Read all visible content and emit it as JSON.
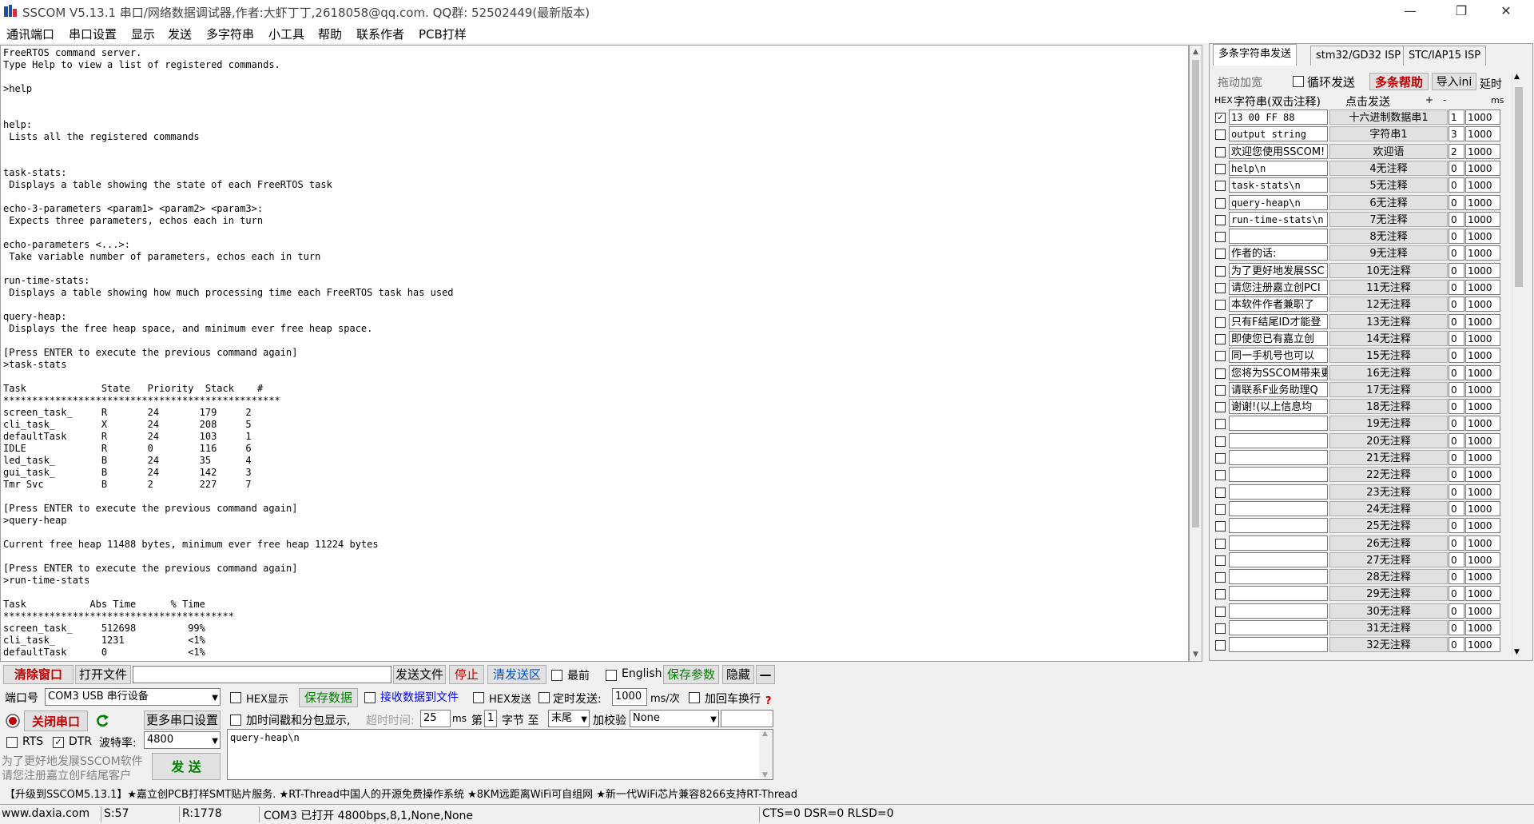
{
  "window": {
    "title": "SSCOM V5.13.1 串口/网络数据调试器,作者:大虾丁丁,2618058@qq.com. QQ群: 52502449(最新版本)",
    "minimize": "—",
    "maximize": "❐",
    "close": "✕"
  },
  "menu": [
    "通讯端口",
    "串口设置",
    "显示",
    "发送",
    "多字符串",
    "小工具",
    "帮助",
    "联系作者",
    "PCB打样"
  ],
  "console": {
    "text": "FreeRTOS command server.\nType Help to view a list of registered commands.\n\n>help\n\n\nhelp:\n Lists all the registered commands\n\n\ntask-stats:\n Displays a table showing the state of each FreeRTOS task\n\necho-3-parameters <param1> <param2> <param3>:\n Expects three parameters, echos each in turn\n\necho-parameters <...>:\n Take variable number of parameters, echos each in turn\n\nrun-time-stats:\n Displays a table showing how much processing time each FreeRTOS task has used\n\nquery-heap:\n Displays the free heap space, and minimum ever free heap space.\n\n[Press ENTER to execute the previous command again]\n>task-stats\n\nTask             State   Priority  Stack    #\n************************************************\nscreen_task_     R       24       179     2\ncli_task_        X       24       208     5\ndefaultTask      R       24       103     1\nIDLE             R       0        116     6\nled_task_        B       24       35      4\ngui_task_        B       24       142     3\nTmr Svc          B       2        227     7\n\n[Press ENTER to execute the previous command again]\n>query-heap\n\nCurrent free heap 11488 bytes, minimum ever free heap 11224 bytes\n\n[Press ENTER to execute the previous command again]\n>run-time-stats\n\nTask           Abs Time      % Time\n****************************************\nscreen_task_     512698         99%\ncli_task_        1231           <1%\ndefaultTask      0              <1%"
  },
  "right_panel": {
    "tabs": [
      "多条字符串发送",
      "stm32/GD32 ISP",
      "STC/IAP15 ISP"
    ],
    "drag_width": "拖动加宽",
    "loop_send": "循环发送",
    "multi_help": "多条帮助",
    "import_ini": "导入ini",
    "delay_label": "延时",
    "col_hex": "HEX",
    "col_string": "字符串(双击注释)",
    "col_click_send": "点击发送",
    "col_plus": "+",
    "col_minus": "-",
    "col_ms": "ms",
    "rows": [
      {
        "checked": true,
        "str": "13 00 FF 88",
        "btn": "十六进制数据串1",
        "ord": "1",
        "delay": "1000"
      },
      {
        "checked": false,
        "str": "output string",
        "btn": "字符串1",
        "ord": "3",
        "delay": "1000"
      },
      {
        "checked": false,
        "str": "欢迎您使用SSCOM!",
        "btn": "欢迎语",
        "ord": "2",
        "delay": "1000"
      },
      {
        "checked": false,
        "str": "help\\n",
        "btn": "4无注释",
        "ord": "0",
        "delay": "1000"
      },
      {
        "checked": false,
        "str": "task-stats\\n",
        "btn": "5无注释",
        "ord": "0",
        "delay": "1000"
      },
      {
        "checked": false,
        "str": "query-heap\\n",
        "btn": "6无注释",
        "ord": "0",
        "delay": "1000"
      },
      {
        "checked": false,
        "str": "run-time-stats\\n",
        "btn": "7无注释",
        "ord": "0",
        "delay": "1000"
      },
      {
        "checked": false,
        "str": "",
        "btn": "8无注释",
        "ord": "0",
        "delay": "1000"
      },
      {
        "checked": false,
        "str": "作者的话:",
        "btn": "9无注释",
        "ord": "0",
        "delay": "1000"
      },
      {
        "checked": false,
        "str": "为了更好地发展SSC",
        "btn": "10无注释",
        "ord": "0",
        "delay": "1000"
      },
      {
        "checked": false,
        "str": "请您注册嘉立创PCI",
        "btn": "11无注释",
        "ord": "0",
        "delay": "1000"
      },
      {
        "checked": false,
        "str": "本软件作者兼职了",
        "btn": "12无注释",
        "ord": "0",
        "delay": "1000"
      },
      {
        "checked": false,
        "str": "只有F结尾ID才能登",
        "btn": "13无注释",
        "ord": "0",
        "delay": "1000"
      },
      {
        "checked": false,
        "str": "即使您已有嘉立创",
        "btn": "14无注释",
        "ord": "0",
        "delay": "1000"
      },
      {
        "checked": false,
        "str": "同一手机号也可以",
        "btn": "15无注释",
        "ord": "0",
        "delay": "1000"
      },
      {
        "checked": false,
        "str": "您将为SSCOM带来更",
        "btn": "16无注释",
        "ord": "0",
        "delay": "1000"
      },
      {
        "checked": false,
        "str": "请联系F业务助理Q",
        "btn": "17无注释",
        "ord": "0",
        "delay": "1000"
      },
      {
        "checked": false,
        "str": "谢谢!(以上信息均",
        "btn": "18无注释",
        "ord": "0",
        "delay": "1000"
      },
      {
        "checked": false,
        "str": "",
        "btn": "19无注释",
        "ord": "0",
        "delay": "1000"
      },
      {
        "checked": false,
        "str": "",
        "btn": "20无注释",
        "ord": "0",
        "delay": "1000"
      },
      {
        "checked": false,
        "str": "",
        "btn": "21无注释",
        "ord": "0",
        "delay": "1000"
      },
      {
        "checked": false,
        "str": "",
        "btn": "22无注释",
        "ord": "0",
        "delay": "1000"
      },
      {
        "checked": false,
        "str": "",
        "btn": "23无注释",
        "ord": "0",
        "delay": "1000"
      },
      {
        "checked": false,
        "str": "",
        "btn": "24无注释",
        "ord": "0",
        "delay": "1000"
      },
      {
        "checked": false,
        "str": "",
        "btn": "25无注释",
        "ord": "0",
        "delay": "1000"
      },
      {
        "checked": false,
        "str": "",
        "btn": "26无注释",
        "ord": "0",
        "delay": "1000"
      },
      {
        "checked": false,
        "str": "",
        "btn": "27无注释",
        "ord": "0",
        "delay": "1000"
      },
      {
        "checked": false,
        "str": "",
        "btn": "28无注释",
        "ord": "0",
        "delay": "1000"
      },
      {
        "checked": false,
        "str": "",
        "btn": "29无注释",
        "ord": "0",
        "delay": "1000"
      },
      {
        "checked": false,
        "str": "",
        "btn": "30无注释",
        "ord": "0",
        "delay": "1000"
      },
      {
        "checked": false,
        "str": "",
        "btn": "31无注释",
        "ord": "0",
        "delay": "1000"
      },
      {
        "checked": false,
        "str": "",
        "btn": "32无注释",
        "ord": "0",
        "delay": "1000"
      }
    ]
  },
  "toolbar": {
    "clear_window": "清除窗口",
    "open_file": "打开文件",
    "file_path": "",
    "send_file": "发送文件",
    "stop": "停止",
    "clear_send": "清发送区",
    "topmost": "最前",
    "english": "English",
    "save_params": "保存参数",
    "hide": "隐藏",
    "collapse": "—"
  },
  "port": {
    "port_label": "端口号",
    "port_value": "COM3 USB 串行设备",
    "hex_display": "HEX显示",
    "save_data": "保存数据",
    "recv_to_file": "接收数据到文件",
    "hex_send": "HEX发送",
    "timed_send": "定时发送:",
    "interval": "1000",
    "interval_unit": "ms/次",
    "add_crlf": "加回车换行",
    "help_mark": "?",
    "close_port": "关闭串口",
    "more_settings": "更多串口设置",
    "timestamp": "加时间戳和分包显示,",
    "timeout_label": "超时时间:",
    "timeout_value": "25",
    "timeout_unit": "ms",
    "nth_label": "第",
    "nth_value": "1",
    "byte_label": "字节 至",
    "to_value": "末尾",
    "checksum_label": "加校验",
    "checksum_value": "None",
    "rts": "RTS",
    "dtr": "DTR",
    "baud_label": "波特率:",
    "baud_value": "4800",
    "send_text": "query-heap\\n",
    "ad_line1": "为了更好地发展SSCOM软件",
    "ad_line2": "请您注册嘉立创F结尾客户",
    "send_btn": "发 送"
  },
  "ticker": "【升级到SSCOM5.13.1】★嘉立创PCB打样SMT贴片服务. ★RT-Thread中国人的开源免费操作系统 ★8KM远距离WiFi可自组网 ★新一代WiFi芯片兼容8266支持RT-Thread",
  "status": {
    "website": "www.daxia.com",
    "sent": "S:57",
    "received": "R:1778",
    "port_state": "COM3 已打开  4800bps,8,1,None,None",
    "lines": "CTS=0 DSR=0 RLSD=0"
  },
  "colors": {
    "accent_red": "#c00000",
    "accent_green": "#008000",
    "accent_blue": "#0000ff"
  }
}
